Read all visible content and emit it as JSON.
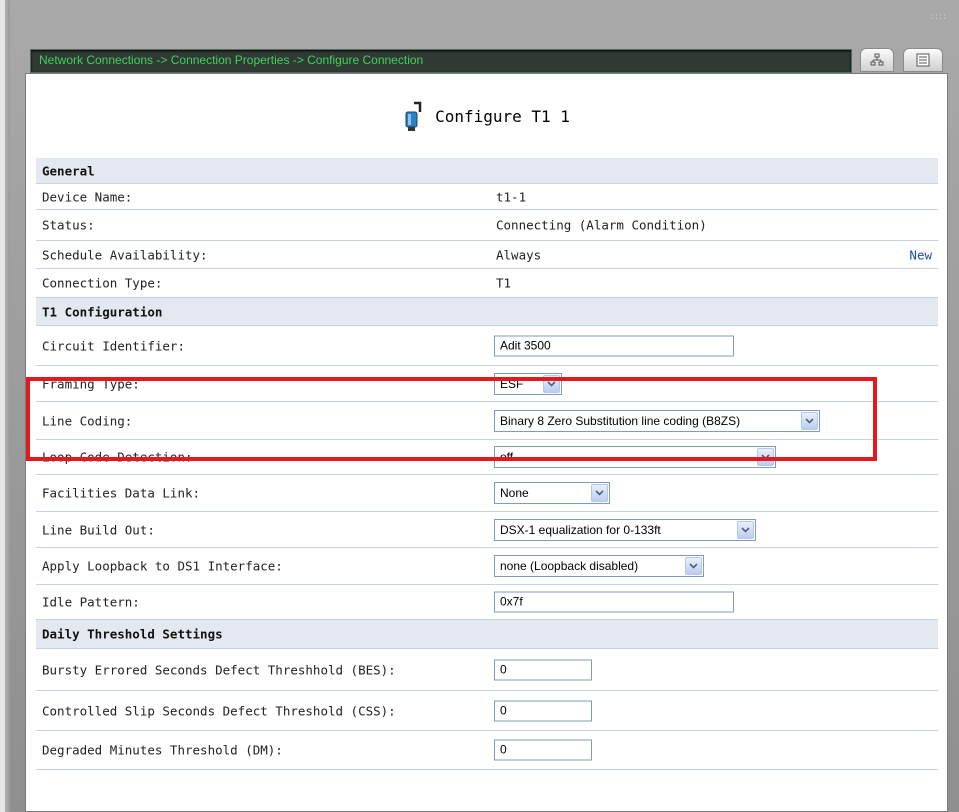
{
  "breadcrumb": "Network Connections -> Connection Properties -> Configure Connection",
  "page_title": "Configure T1 1",
  "sections": {
    "general": "General",
    "t1_config": "T1 Configuration",
    "daily": "Daily Threshold Settings"
  },
  "general": {
    "device_name_label": "Device Name:",
    "device_name_value": "t1-1",
    "status_label": "Status:",
    "status_value": "Connecting (Alarm Condition)",
    "schedule_label": "Schedule Availability:",
    "schedule_value": "Always",
    "schedule_link": "New",
    "connection_type_label": "Connection Type:",
    "connection_type_value": "T1"
  },
  "t1": {
    "circuit_label": "Circuit Identifier:",
    "circuit_value": "Adit 3500",
    "framing_label": "Framing Type:",
    "framing_value": "ESF",
    "line_coding_label": "Line Coding:",
    "line_coding_value": "Binary 8 Zero Substitution line coding (B8ZS)",
    "loop_code_label": "Loop Code Detection:",
    "loop_code_value": "off",
    "fdl_label": "Facilities Data Link:",
    "fdl_value": "None",
    "lbo_label": "Line Build Out:",
    "lbo_value": "DSX-1 equalization for 0-133ft",
    "loopback_label": "Apply Loopback to DS1 Interface:",
    "loopback_value": "none (Loopback disabled)",
    "idle_label": "Idle Pattern:",
    "idle_value": "0x7f"
  },
  "daily": {
    "bes_label": "Bursty Errored Seconds Defect Threshhold (BES):",
    "bes_value": "0",
    "css_label": "Controlled Slip Seconds Defect Threshold (CSS):",
    "css_value": "0",
    "dm_label": "Degraded Minutes Threshold (DM):",
    "dm_value": "0"
  },
  "colors": {
    "highlight": "#e3191f",
    "breadcrumb_text": "#3ed35e",
    "section_bg": "#e4e9f1",
    "link": "#1c4fa3"
  },
  "icons": {
    "title": "connector-icon",
    "top_button_1": "network-tree-icon",
    "top_button_2": "list-view-icon",
    "dropdown": "chevron-down-icon"
  }
}
